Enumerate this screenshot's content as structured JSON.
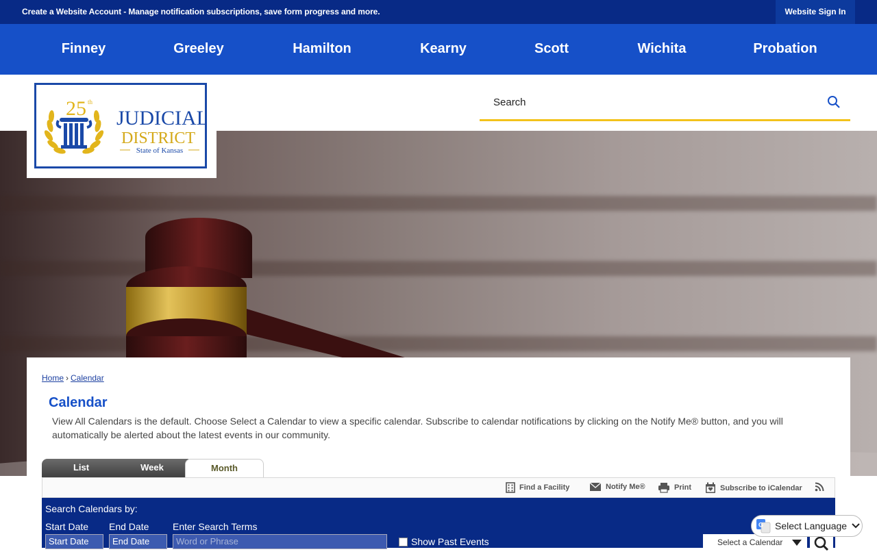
{
  "topbar": {
    "account_text": "Create a Website Account - Manage notification subscriptions, save form progress and more.",
    "signin_label": "Website Sign In"
  },
  "nav": {
    "items": [
      {
        "label": "Finney"
      },
      {
        "label": "Greeley"
      },
      {
        "label": "Hamilton"
      },
      {
        "label": "Kearny"
      },
      {
        "label": "Scott"
      },
      {
        "label": "Wichita"
      },
      {
        "label": "Probation"
      }
    ]
  },
  "logo": {
    "number": "25",
    "suffix": "th",
    "line1": "JUDICIAL",
    "line2": "DISTRICT",
    "line3": "State of Kansas"
  },
  "search": {
    "placeholder": "Search",
    "icon": "search-icon"
  },
  "breadcrumb": {
    "home": "Home",
    "separator": "›",
    "current": "Calendar"
  },
  "page": {
    "title": "Calendar",
    "intro": "View All Calendars is the default. Choose Select a Calendar to view a specific calendar. Subscribe to calendar notifications by clicking on the Notify Me® button, and you will automatically be alerted about the latest events in our community."
  },
  "tabs": {
    "list": "List",
    "week": "Week",
    "month": "Month"
  },
  "toolbar": {
    "find_facility": "Find a Facility",
    "notify_me": "Notify Me®",
    "print": "Print",
    "subscribe": "Subscribe to iCalendar"
  },
  "search_panel": {
    "title": "Search Calendars by:",
    "start_label": "Start Date",
    "end_label": "End Date",
    "terms_label": "Enter Search Terms",
    "start_value": "Start Date",
    "end_value": "End Date",
    "terms_placeholder": "Word or Phrase",
    "past_events_label": "Show Past Events",
    "select_calendar": "Select a Calendar"
  },
  "language": {
    "label": "Select Language"
  },
  "colors": {
    "topbar": "#082a86",
    "nav": "#1650c8",
    "accent_gold": "#f3c21b",
    "title_blue": "#1650c8"
  }
}
